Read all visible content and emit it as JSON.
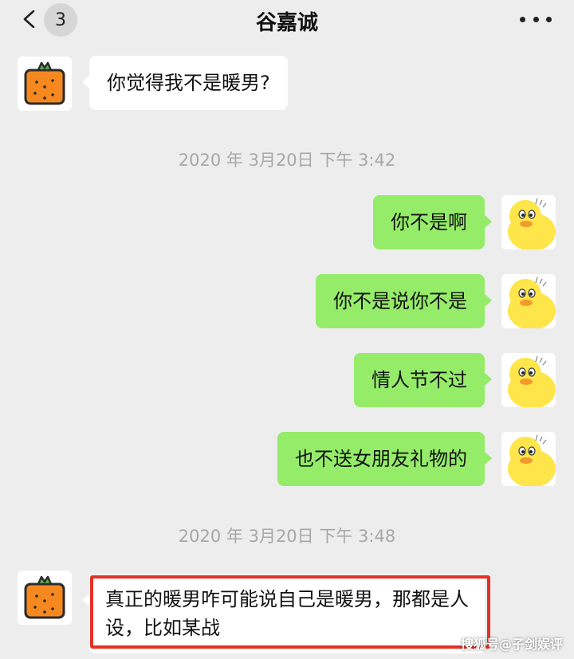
{
  "header": {
    "title": "谷嘉诚",
    "unread_count": "3",
    "back_icon": "chevron-left-icon",
    "more_icon": "more-dots-icon"
  },
  "messages": [
    {
      "side": "left",
      "text": "你觉得我不是暖男?",
      "avatar": "orange-avatar-icon"
    },
    {
      "side": "time",
      "text": "2020 年 3月20日 下午 3:42"
    },
    {
      "side": "right",
      "text": "你不是啊",
      "avatar": "yellow-duck-avatar-icon"
    },
    {
      "side": "right",
      "text": "你不是说你不是",
      "avatar": "yellow-duck-avatar-icon"
    },
    {
      "side": "right",
      "text": "情人节不过",
      "avatar": "yellow-duck-avatar-icon"
    },
    {
      "side": "right",
      "text": "也不送女朋友礼物的",
      "avatar": "yellow-duck-avatar-icon"
    },
    {
      "side": "time",
      "text": "2020 年 3月20日 下午 3:48"
    },
    {
      "side": "left",
      "text": "真正的暖男咋可能说自己是暖男，那都是人设，比如某战",
      "avatar": "orange-avatar-icon",
      "highlighted": true
    }
  ],
  "colors": {
    "background": "#ededed",
    "self_bubble": "#95ec69",
    "other_bubble": "#ffffff",
    "highlight": "#e53025"
  },
  "watermark": "搜狐号@子剑娱评"
}
